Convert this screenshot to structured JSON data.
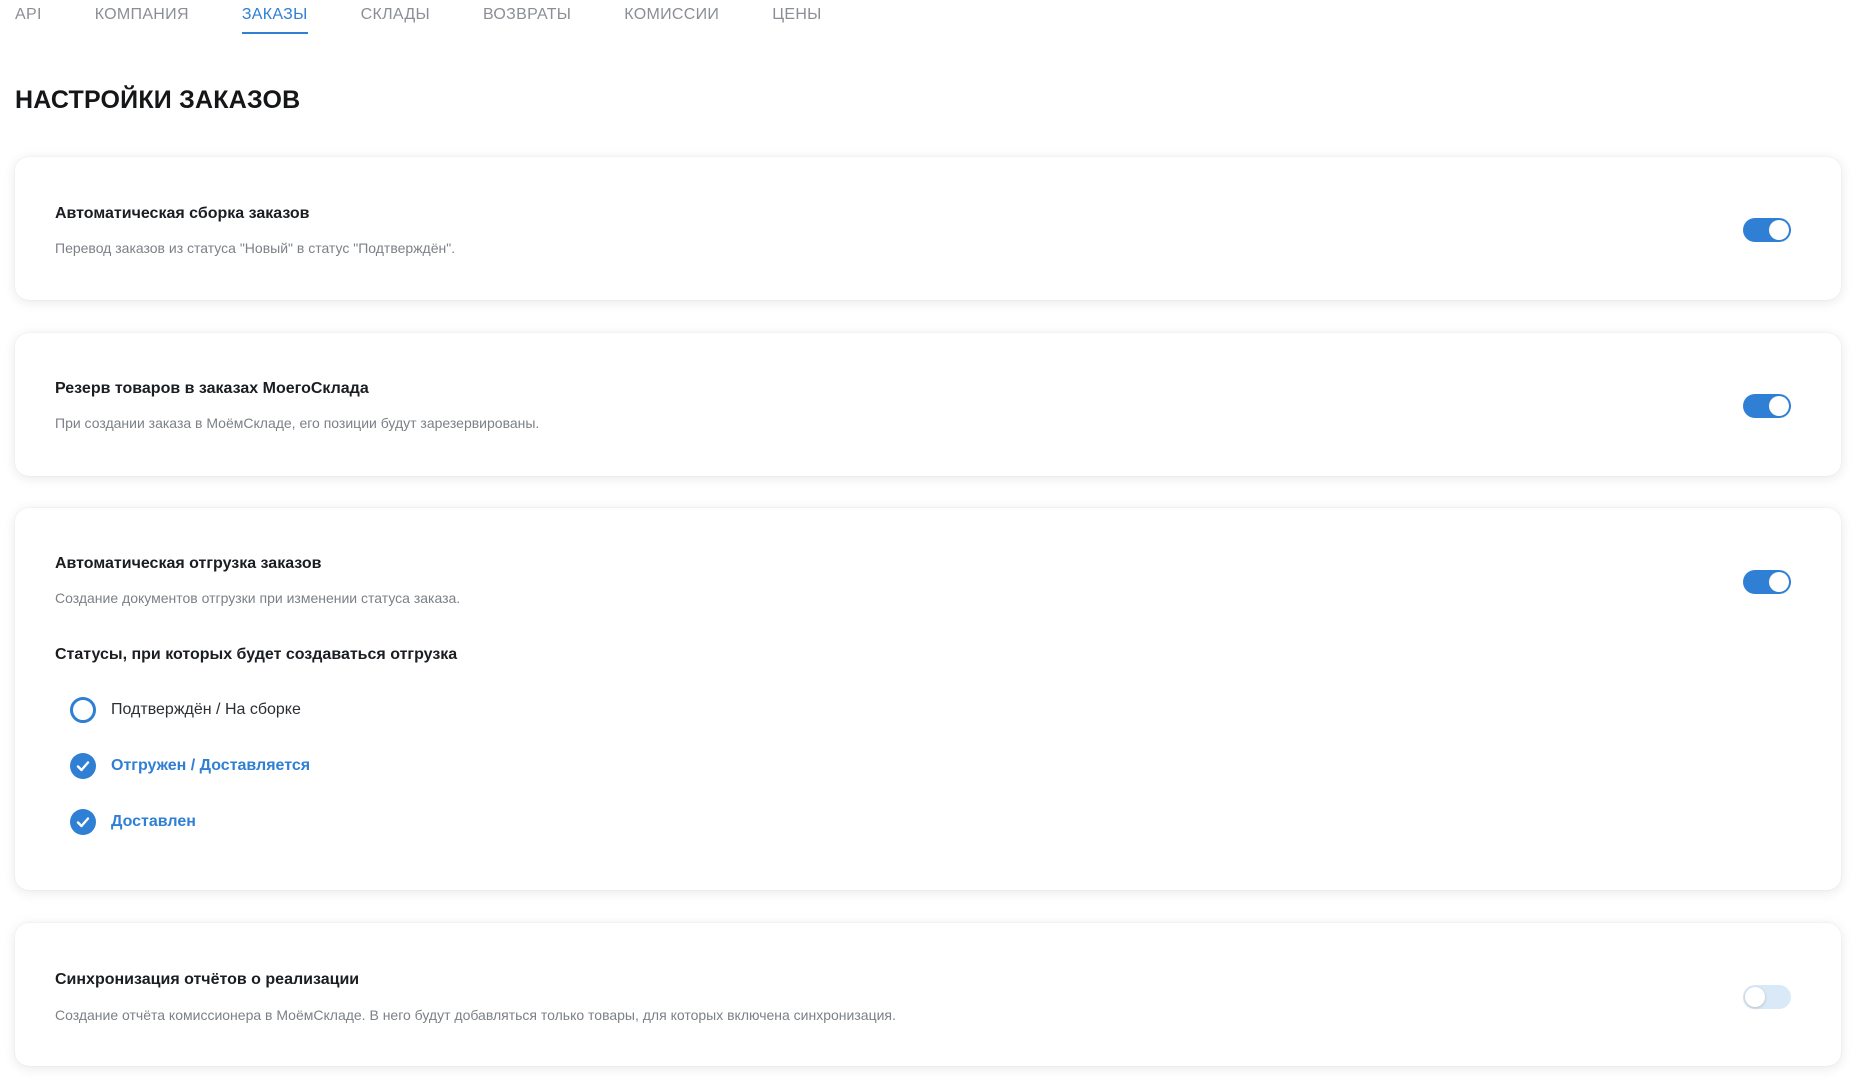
{
  "tabs": [
    {
      "label": "API",
      "active": false
    },
    {
      "label": "КОМПАНИЯ",
      "active": false
    },
    {
      "label": "ЗАКАЗЫ",
      "active": true
    },
    {
      "label": "СКЛАДЫ",
      "active": false
    },
    {
      "label": "ВОЗВРАТЫ",
      "active": false
    },
    {
      "label": "КОМИССИИ",
      "active": false
    },
    {
      "label": "ЦЕНЫ",
      "active": false
    }
  ],
  "page_title": "НАСТРОЙКИ ЗАКАЗОВ",
  "settings": [
    {
      "title": "Автоматическая сборка заказов",
      "description": "Перевод заказов из статуса \"Новый\" в статус \"Подтверждён\".",
      "enabled": true
    },
    {
      "title": "Резерв товаров в заказах МоегоСклада",
      "description": "При создании заказа в МоёмСкладе, его позиции будут зарезервированы.",
      "enabled": true
    },
    {
      "title": "Автоматическая отгрузка заказов",
      "description": "Создание документов отгрузки при изменении статуса заказа.",
      "enabled": true,
      "statuses_title": "Статусы, при которых будет создаваться отгрузка",
      "statuses": [
        {
          "label": "Подтверждён / На сборке",
          "checked": false
        },
        {
          "label": "Отгружен / Доставляется",
          "checked": true
        },
        {
          "label": "Доставлен",
          "checked": true
        }
      ]
    },
    {
      "title": "Синхронизация отчётов о реализации",
      "description": "Создание отчёта комиссионера в МоёмСкладе. В него будут добавляться только товары, для которых включена синхронизация.",
      "enabled": false
    }
  ],
  "colors": {
    "accent": "#2f7fd4",
    "toggle_off": "#d9e9f7",
    "muted_text": "#7c8187",
    "tab_inactive": "#8b8f95"
  }
}
